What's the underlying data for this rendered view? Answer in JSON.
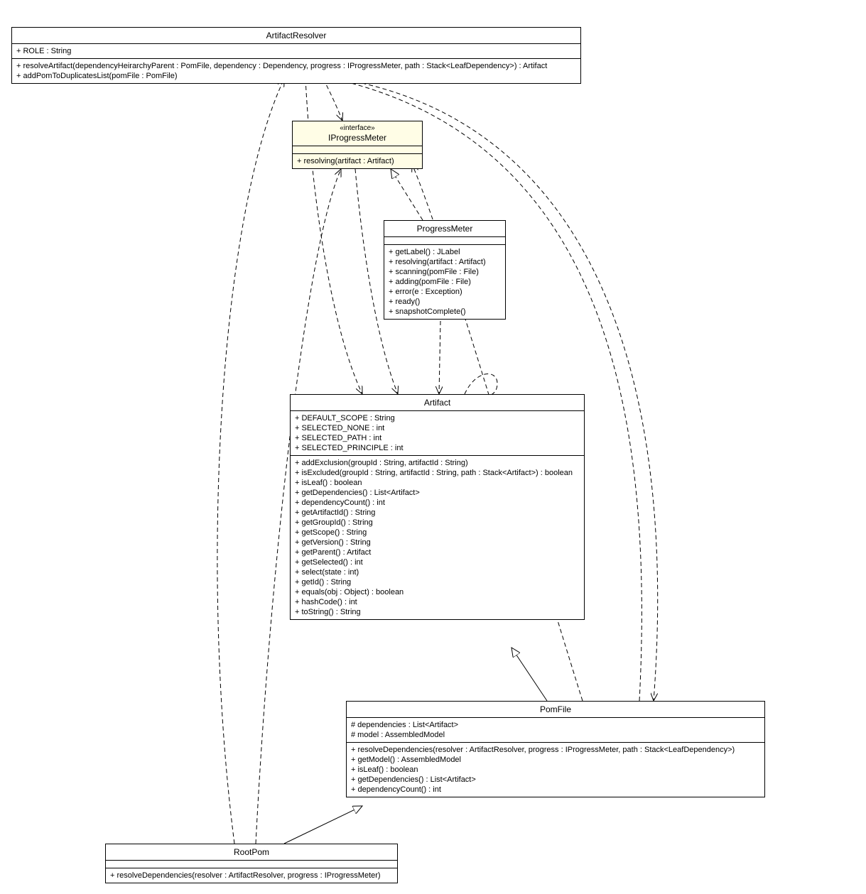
{
  "classes": {
    "artifactResolver": {
      "name": "ArtifactResolver",
      "attrs": [
        "+ ROLE : String"
      ],
      "ops": [
        "+ resolveArtifact(dependencyHeirarchyParent : PomFile, dependency : Dependency, progress : IProgressMeter, path : Stack<LeafDependency>) : Artifact",
        "+ addPomToDuplicatesList(pomFile : PomFile)"
      ]
    },
    "iProgressMeter": {
      "stereotype": "«interface»",
      "name": "IProgressMeter",
      "ops": [
        "+ resolving(artifact : Artifact)"
      ]
    },
    "progressMeter": {
      "name": "ProgressMeter",
      "ops": [
        "+ getLabel() : JLabel",
        "+ resolving(artifact : Artifact)",
        "+ scanning(pomFile : File)",
        "+ adding(pomFile : File)",
        "+ error(e : Exception)",
        "+ ready()",
        "+ snapshotComplete()"
      ]
    },
    "artifact": {
      "name": "Artifact",
      "attrs": [
        "+ DEFAULT_SCOPE : String",
        "+ SELECTED_NONE : int",
        "+ SELECTED_PATH : int",
        "+ SELECTED_PRINCIPLE : int"
      ],
      "ops": [
        "+ addExclusion(groupId : String, artifactId : String)",
        "+ isExcluded(groupId : String, artifactId : String, path : Stack<Artifact>) : boolean",
        "+ isLeaf() : boolean",
        "+ getDependencies() : List<Artifact>",
        "+ dependencyCount() : int",
        "+ getArtifactId() : String",
        "+ getGroupId() : String",
        "+ getScope() : String",
        "+ getVersion() : String",
        "+ getParent() : Artifact",
        "+ getSelected() : int",
        "+ select(state : int)",
        "+ getId() : String",
        "+ equals(obj : Object) : boolean",
        "+ hashCode() : int",
        "+ toString() : String"
      ]
    },
    "pomFile": {
      "name": "PomFile",
      "attrs": [
        "# dependencies : List<Artifact>",
        "# model : AssembledModel"
      ],
      "ops": [
        "+ resolveDependencies(resolver : ArtifactResolver, progress : IProgressMeter, path : Stack<LeafDependency>)",
        "+ getModel() : AssembledModel",
        "+ isLeaf() : boolean",
        "+ getDependencies() : List<Artifact>",
        "+ dependencyCount() : int"
      ]
    },
    "rootPom": {
      "name": "RootPom",
      "ops": [
        "+ resolveDependencies(resolver : ArtifactResolver, progress : IProgressMeter)"
      ]
    }
  },
  "chart_data": {
    "type": "uml_class_diagram",
    "classes": [
      {
        "name": "ArtifactResolver",
        "attrs": [
          "+ ROLE : String"
        ],
        "ops": [
          "+ resolveArtifact(dependencyHeirarchyParent : PomFile, dependency : Dependency, progress : IProgressMeter, path : Stack<LeafDependency>) : Artifact",
          "+ addPomToDuplicatesList(pomFile : PomFile)"
        ]
      },
      {
        "name": "IProgressMeter",
        "stereotype": "interface",
        "ops": [
          "+ resolving(artifact : Artifact)"
        ]
      },
      {
        "name": "ProgressMeter",
        "ops": [
          "+ getLabel() : JLabel",
          "+ resolving(artifact : Artifact)",
          "+ scanning(pomFile : File)",
          "+ adding(pomFile : File)",
          "+ error(e : Exception)",
          "+ ready()",
          "+ snapshotComplete()"
        ]
      },
      {
        "name": "Artifact",
        "attrs": [
          "+ DEFAULT_SCOPE : String",
          "+ SELECTED_NONE : int",
          "+ SELECTED_PATH : int",
          "+ SELECTED_PRINCIPLE : int"
        ],
        "ops": [
          "+ addExclusion(groupId : String, artifactId : String)",
          "+ isExcluded(groupId : String, artifactId : String, path : Stack<Artifact>) : boolean",
          "+ isLeaf() : boolean",
          "+ getDependencies() : List<Artifact>",
          "+ dependencyCount() : int",
          "+ getArtifactId() : String",
          "+ getGroupId() : String",
          "+ getScope() : String",
          "+ getVersion() : String",
          "+ getParent() : Artifact",
          "+ getSelected() : int",
          "+ select(state : int)",
          "+ getId() : String",
          "+ equals(obj : Object) : boolean",
          "+ hashCode() : int",
          "+ toString() : String"
        ]
      },
      {
        "name": "PomFile",
        "attrs": [
          "# dependencies : List<Artifact>",
          "# model : AssembledModel"
        ],
        "ops": [
          "+ resolveDependencies(resolver : ArtifactResolver, progress : IProgressMeter, path : Stack<LeafDependency>)",
          "+ getModel() : AssembledModel",
          "+ isLeaf() : boolean",
          "+ getDependencies() : List<Artifact>",
          "+ dependencyCount() : int"
        ]
      },
      {
        "name": "RootPom",
        "ops": [
          "+ resolveDependencies(resolver : ArtifactResolver, progress : IProgressMeter)"
        ]
      }
    ],
    "relations": [
      {
        "from": "ArtifactResolver",
        "to": "IProgressMeter",
        "type": "dependency"
      },
      {
        "from": "ArtifactResolver",
        "to": "Artifact",
        "type": "dependency"
      },
      {
        "from": "ArtifactResolver",
        "to": "PomFile",
        "type": "dependency"
      },
      {
        "from": "IProgressMeter",
        "to": "Artifact",
        "type": "dependency"
      },
      {
        "from": "ProgressMeter",
        "to": "IProgressMeter",
        "type": "realization"
      },
      {
        "from": "ProgressMeter",
        "to": "Artifact",
        "type": "dependency"
      },
      {
        "from": "Artifact",
        "to": "Artifact",
        "type": "dependency_self"
      },
      {
        "from": "PomFile",
        "to": "Artifact",
        "type": "generalization"
      },
      {
        "from": "PomFile",
        "to": "ArtifactResolver",
        "type": "dependency"
      },
      {
        "from": "PomFile",
        "to": "IProgressMeter",
        "type": "dependency"
      },
      {
        "from": "RootPom",
        "to": "PomFile",
        "type": "generalization"
      },
      {
        "from": "RootPom",
        "to": "ArtifactResolver",
        "type": "dependency"
      },
      {
        "from": "RootPom",
        "to": "IProgressMeter",
        "type": "dependency"
      }
    ]
  }
}
